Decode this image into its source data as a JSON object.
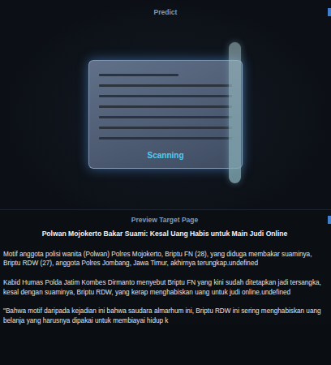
{
  "header": {
    "title": "Predict"
  },
  "scanner": {
    "label": "Scanning"
  },
  "preview": {
    "title": "Preview Target Page",
    "headline": "Polwan Mojokerto Bakar Suami: Kesal Uang Habis untuk Main Judi Online",
    "paragraphs": [
      "Motif anggota polisi wanita (Polwan) Polres Mojokerto, Briptu FN (28), yang diduga membakar suaminya, Briptu RDW (27), anggota Polres Jombang, Jawa Timur, akhirnya terungkap.undefined",
      "Kabid Humas Polda Jatim Kombes Dirmanto menyebut Briptu FN yang kini sudah ditetapkan jadi tersangka, kesal dengan suaminya, Briptu RDW, yang kerap menghabiskan uang untuk judi online.undefined",
      "\"Bahwa motif daripada kejadian ini bahwa saudara almarhum ini, Briptu RDW ini sering menghabiskan uang belanja yang harusnya dipakai untuk membiayai hidup k"
    ]
  }
}
